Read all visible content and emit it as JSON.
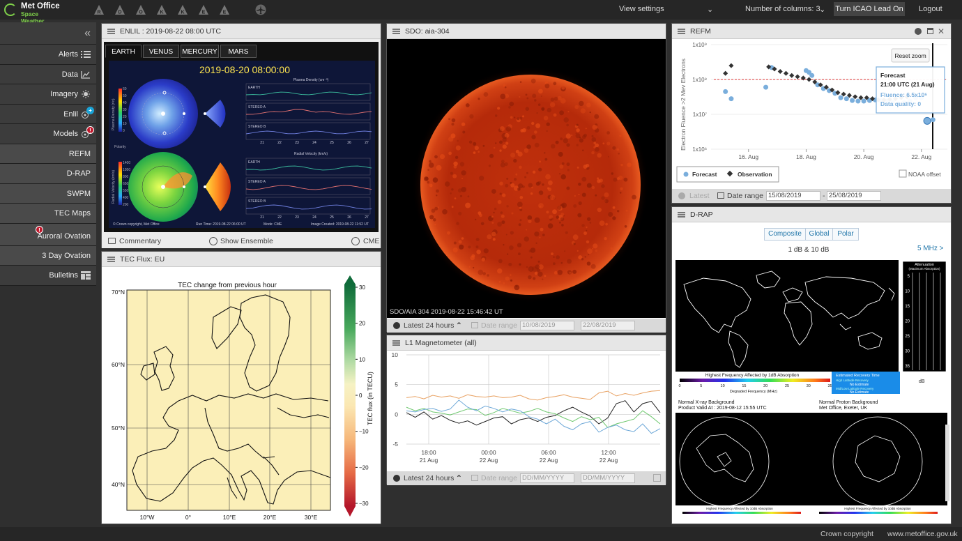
{
  "brand": {
    "line1": "Met Office",
    "line2": "Space Weather"
  },
  "warnings": [
    "R",
    "D",
    "O",
    "K",
    "K",
    "E",
    "E"
  ],
  "topbar": {
    "view_settings": "View settings",
    "columns": "Number of columns: 3",
    "icao_button": "Turn ICAO Lead On",
    "logout": "Logout"
  },
  "sidebar": {
    "collapse": "«",
    "items": [
      {
        "label": "Alerts",
        "icon": "list-icon"
      },
      {
        "label": "Data",
        "icon": "chart-icon"
      },
      {
        "label": "Imagery",
        "icon": "sun-icon"
      },
      {
        "label": "Enlil",
        "icon": "orbit-icon",
        "badge": "+"
      },
      {
        "label": "Models",
        "icon": "orbit-icon",
        "badge": "!"
      },
      {
        "label": "REFM"
      },
      {
        "label": "D-RAP"
      },
      {
        "label": "SWPM"
      },
      {
        "label": "TEC Maps"
      },
      {
        "label": "Auroral Ovation",
        "badge": "!"
      },
      {
        "label": "3 Day Ovation"
      },
      {
        "label": "Bulletins",
        "icon": "grid-icon"
      }
    ]
  },
  "enlil": {
    "title": "ENLIL : 2019-08-22 08:00 UTC",
    "tabs": [
      "EARTH",
      "VENUS",
      "MERCURY",
      "MARS"
    ],
    "image_time": "2019-08-20  08:00:00",
    "top_colorbar": "Plasma Density (r²n)",
    "bottom_colorbar": "Radial Velocity (km/s)",
    "polarity": "Polarity",
    "top_chart_title": "Plasma Density (cm⁻³)",
    "bottom_chart_title": "Radial Velocity (km/s)",
    "rows": [
      "EARTH",
      "STEREO A",
      "STEREO B"
    ],
    "days": [
      "21",
      "22",
      "23",
      "24",
      "25",
      "26",
      "27"
    ],
    "top_ticks": [
      "60",
      "50",
      "40",
      "30",
      "20",
      "10",
      "0"
    ],
    "bottom_ticks": [
      "1400",
      "1050",
      "800",
      "650",
      "550",
      "400",
      "200"
    ],
    "credit": "© Crown copyright, Met Office",
    "run_time": "Run Time: 2019-08-22 06:00 UT",
    "mode": "Mode: CME",
    "created": "Image Created: 2019-08-22 11:52 UT",
    "footer": {
      "commentary": "Commentary",
      "ensemble": "Show Ensemble",
      "cme": "CME"
    }
  },
  "tec": {
    "title": "TEC Flux: EU",
    "chart_title": "TEC change from previous hour",
    "lat_labels": [
      "70°N",
      "60°N",
      "50°N",
      "40°N"
    ],
    "lon_labels": [
      "10°W",
      "0°",
      "10°E",
      "20°E",
      "30°E"
    ],
    "cbar_label": "TEC flux (in TECU)",
    "cbar_ticks": [
      "30",
      "20",
      "10",
      "0",
      "−10",
      "−20",
      "−30"
    ]
  },
  "sdo": {
    "title": "SDO: aia-304",
    "caption": "SDO/AIA  304    2019-08-22 15:46:42 UT",
    "footer": {
      "range": "Latest 24 hours",
      "date_range": "Date range",
      "from": "10/08/2019",
      "to": "22/08/2019"
    }
  },
  "mag": {
    "title": "L1 Magnetometer (all)",
    "footer": {
      "range": "Latest 24 hours",
      "date_range": "Date range",
      "from_placeholder": "DD/MM/YYYY",
      "to_placeholder": "DD/MM/YYYY"
    }
  },
  "refm": {
    "title": "REFM",
    "reset_zoom": "Reset zoom",
    "ylabel": "Electron Fluence >2 Mev Electrons",
    "tooltip": {
      "title": "Forecast",
      "time": "21:00 UTC (21 Aug)",
      "fluence": "Fluence: 6.5x10⁶",
      "quality": "Data quality: 0"
    },
    "legend": {
      "forecast": "Forecast",
      "observation": "Observation"
    },
    "noaa": "NOAA offset",
    "footer": {
      "latest": "Latest",
      "date_range": "Date range",
      "from": "15/08/2019",
      "to": "25/08/2019",
      "sep": "-"
    }
  },
  "drap": {
    "title": "D-RAP",
    "modes": [
      "Composite",
      "Global",
      "Polar"
    ],
    "subtitle": "1 dB & 10 dB",
    "freq_link": "5 MHz >",
    "atten_title": "Attenuation",
    "atten_sub": "(Maximum Absorption)",
    "atten_ticks": [
      "5",
      "10",
      "15",
      "20",
      "25",
      "30",
      "35"
    ],
    "atten_unit": "dB",
    "hf_title": "Highest Frequency Affected by 1dB Absorption",
    "hf_ticks": [
      "0",
      "5",
      "10",
      "15",
      "20",
      "25",
      "30",
      "35"
    ],
    "hf_label": "Degraded Frequency (MHz)",
    "recovery_title": "Estimated Recovery Time",
    "recovery_rows": [
      "High Latitude Recovery",
      "No Estimate",
      "Mid/Low Latitude Recovery",
      "No Estimate"
    ],
    "xray_bg": "Normal X-ray Background",
    "valid": "Product Valid At : 2019-08-12 15:55 UTC",
    "proton_bg": "Normal Proton Background",
    "issuer": "Met Office, Exeter, UK",
    "polar_caption": "Highest Frequency Affected by 10dB Absorption"
  },
  "footer": {
    "copyright": "Crown copyright",
    "url": "www.metoffice.gov.uk"
  },
  "chart_data": [
    {
      "type": "scatter",
      "title": "REFM",
      "ylabel": "Electron Fluence >2 Mev Electrons",
      "yscale": "log",
      "ylim": [
        1000000,
        1000000000
      ],
      "y_ticks": [
        "1x10⁶",
        "1x10⁷",
        "1x10⁸",
        "1x10⁹"
      ],
      "x_ticks": [
        "16. Aug",
        "18. Aug",
        "20. Aug",
        "22. Aug"
      ],
      "threshold": 100000000,
      "legend": "bottom-left",
      "series": [
        {
          "name": "Observation",
          "color": "#333333",
          "x": [
            15.2,
            15.4,
            16.7,
            16.9,
            17.1,
            17.3,
            17.5,
            17.7,
            17.9,
            18.1,
            18.3,
            18.5,
            18.7,
            18.9,
            19.1,
            19.3,
            19.5,
            19.7,
            19.9,
            20.1,
            20.3,
            20.5,
            20.7,
            20.9,
            21.1,
            21.3,
            21.5
          ],
          "y": [
            150000000,
            250000000,
            230000000,
            200000000,
            170000000,
            150000000,
            130000000,
            120000000,
            110000000,
            100000000,
            85000000,
            70000000,
            60000000,
            50000000,
            42000000,
            38000000,
            35000000,
            32000000,
            30000000,
            30000000,
            28000000,
            26000000,
            26000000,
            27000000,
            28000000,
            30000000,
            32000000
          ]
        },
        {
          "name": "Forecast",
          "color": "#7aaedc",
          "x": [
            15.2,
            15.4,
            16.6,
            16.8,
            18.0,
            18.1,
            18.2,
            18.4,
            18.6,
            18.8,
            19.0,
            19.2,
            19.4,
            19.6,
            19.8,
            20.0,
            20.2,
            20.4,
            20.6,
            20.8,
            21.0,
            21.2,
            21.4,
            21.6,
            21.8,
            22.0,
            22.2,
            22.4
          ],
          "y": [
            45000000,
            28000000,
            60000000,
            220000000,
            180000000,
            160000000,
            130000000,
            70000000,
            55000000,
            48000000,
            40000000,
            30000000,
            28000000,
            25000000,
            24000000,
            24000000,
            25000000,
            26000000,
            25000000,
            24000000,
            22000000,
            20000000,
            22000000,
            24000000,
            30000000,
            30000000,
            6500000,
            7000000
          ]
        }
      ]
    },
    {
      "type": "line",
      "title": "L1 Magnetometer (all)",
      "ylim": [
        -5,
        10
      ],
      "y_ticks": [
        "10",
        "5",
        "0",
        "-5"
      ],
      "x_ticks": [
        "18:00\n21 Aug",
        "00:00\n22 Aug",
        "06:00\n22 Aug",
        "12:00\n22 Aug"
      ],
      "grid": true,
      "series": [
        {
          "color": "#e8a060",
          "values": [
            2.8,
            3.0,
            2.6,
            3.2,
            2.9,
            3.1,
            2.7,
            3.3,
            3.0,
            2.9,
            3.1,
            2.8,
            2.9,
            3.2,
            2.6,
            2.4,
            2.8,
            3.0,
            3.3,
            2.9,
            2.7,
            2.5,
            3.6,
            3.9,
            3.1,
            3.5,
            3.2,
            3.6,
            3.9,
            4.0
          ]
        },
        {
          "color": "#222222",
          "values": [
            0.3,
            -0.5,
            0.4,
            -0.8,
            -0.2,
            -1.0,
            -1.5,
            -1.1,
            -1.8,
            -1.2,
            -0.6,
            -0.4,
            -1.6,
            -0.9,
            -0.6,
            -1.2,
            -0.5,
            -0.2,
            0.6,
            1.2,
            0.4,
            -0.3,
            -1.6,
            -0.6,
            1.8,
            2.3,
            0.4,
            1.8,
            2.2,
            0.3
          ]
        },
        {
          "color": "#6fc86f",
          "values": [
            1.2,
            0.6,
            1.0,
            0.4,
            0.2,
            -0.1,
            0.4,
            0.9,
            0.8,
            -0.2,
            0.3,
            1.0,
            0.6,
            0.2,
            0.5,
            1.0,
            0.4,
            0.1,
            -0.6,
            -1.2,
            -0.4,
            -0.9,
            -0.5,
            -2.2,
            -1.6,
            -1.2,
            -0.8,
            0.6,
            -0.4,
            -1.6
          ]
        },
        {
          "color": "#6ea8d8",
          "values": [
            0.6,
            0.4,
            0.8,
            1.0,
            0.5,
            0.9,
            2.4,
            1.2,
            0.6,
            1.4,
            1.0,
            0.4,
            0.9,
            0.6,
            -0.4,
            -0.8,
            -1.6,
            -0.8,
            -2.0,
            -2.6,
            -1.6,
            -1.2,
            -3.0,
            -2.2,
            -1.8,
            -2.6,
            -2.9,
            -1.6,
            -3.2,
            -2.4
          ]
        }
      ]
    }
  ]
}
